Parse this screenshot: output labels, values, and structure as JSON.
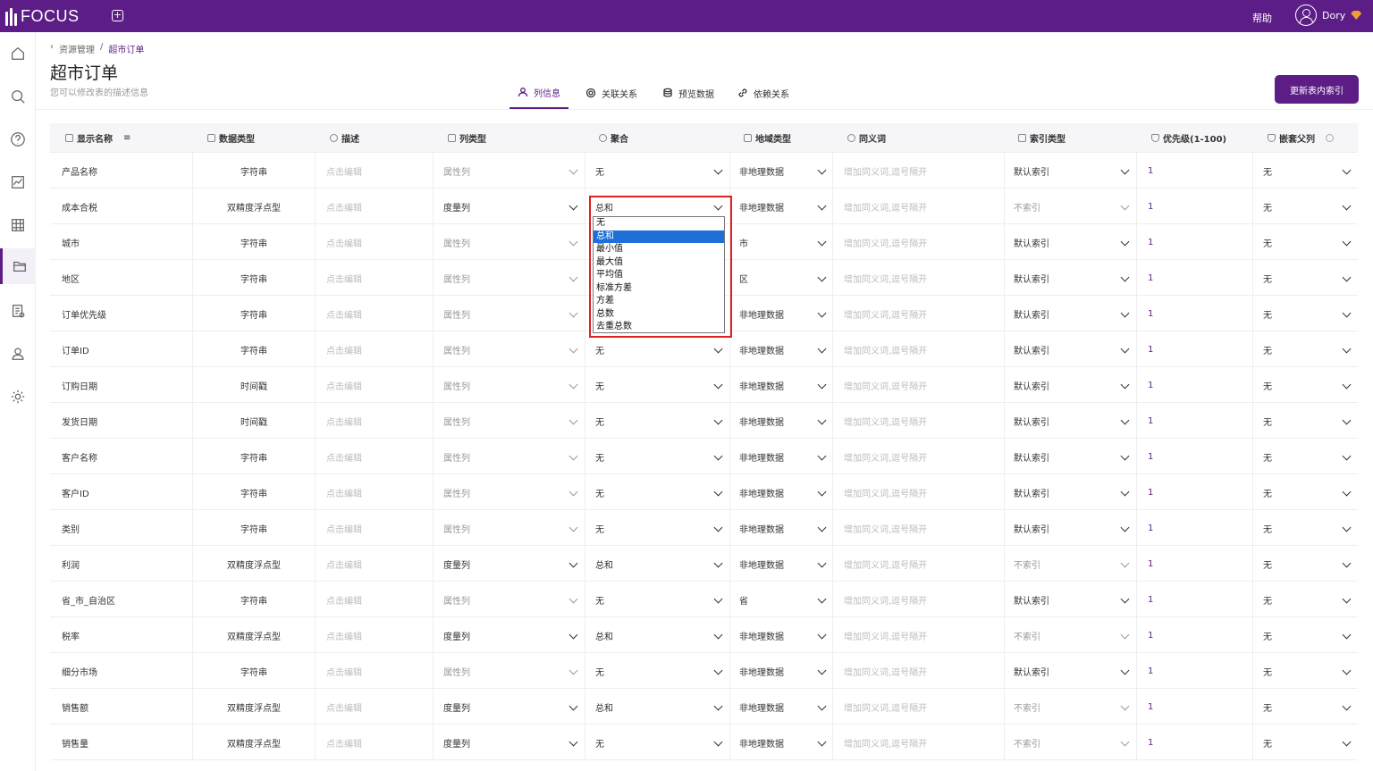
{
  "app": {
    "name": "FOCUS",
    "help": "帮助",
    "user": "Dory"
  },
  "breadcrumb": {
    "parent": "资源管理",
    "sep": "/",
    "current": "超市订单"
  },
  "page": {
    "title": "超市订单",
    "subtitle": "您可以修改表的描述信息"
  },
  "tabs": [
    "列信息",
    "关联关系",
    "预览数据",
    "依赖关系"
  ],
  "update_button": "更新表内索引",
  "columns": [
    "显示名称",
    "数据类型",
    "描述",
    "列类型",
    "聚合",
    "地域类型",
    "同义词",
    "索引类型",
    "优先级(1-100)",
    "嵌套父列"
  ],
  "placeholders": {
    "description": "点击编辑",
    "synonym": "增加同义词,逗号隔开"
  },
  "rows": [
    [
      "产品名称",
      "字符串",
      "属性列",
      "无",
      "非地理数据",
      "默认索引",
      "1",
      "无"
    ],
    [
      "成本合税",
      "双精度浮点型",
      "度量列",
      "总和",
      "非地理数据",
      "不索引",
      "1",
      "无"
    ],
    [
      "城市",
      "字符串",
      "属性列",
      "无",
      "市",
      "默认索引",
      "1",
      "无"
    ],
    [
      "地区",
      "字符串",
      "属性列",
      "无",
      "区",
      "默认索引",
      "1",
      "无"
    ],
    [
      "订单优先级",
      "字符串",
      "属性列",
      "无",
      "非地理数据",
      "默认索引",
      "1",
      "无"
    ],
    [
      "订单ID",
      "字符串",
      "属性列",
      "无",
      "非地理数据",
      "默认索引",
      "1",
      "无"
    ],
    [
      "订购日期",
      "时间戳",
      "属性列",
      "无",
      "非地理数据",
      "默认索引",
      "1",
      "无"
    ],
    [
      "发货日期",
      "时间戳",
      "属性列",
      "无",
      "非地理数据",
      "默认索引",
      "1",
      "无"
    ],
    [
      "客户名称",
      "字符串",
      "属性列",
      "无",
      "非地理数据",
      "默认索引",
      "1",
      "无"
    ],
    [
      "客户ID",
      "字符串",
      "属性列",
      "无",
      "非地理数据",
      "默认索引",
      "1",
      "无"
    ],
    [
      "类别",
      "字符串",
      "属性列",
      "无",
      "非地理数据",
      "默认索引",
      "1",
      "无"
    ],
    [
      "利润",
      "双精度浮点型",
      "度量列",
      "总和",
      "非地理数据",
      "不索引",
      "1",
      "无"
    ],
    [
      "省_市_自治区",
      "字符串",
      "属性列",
      "无",
      "省",
      "默认索引",
      "1",
      "无"
    ],
    [
      "税率",
      "双精度浮点型",
      "度量列",
      "总和",
      "非地理数据",
      "不索引",
      "1",
      "无"
    ],
    [
      "细分市场",
      "字符串",
      "属性列",
      "无",
      "非地理数据",
      "默认索引",
      "1",
      "无"
    ],
    [
      "销售额",
      "双精度浮点型",
      "度量列",
      "总和",
      "非地理数据",
      "不索引",
      "1",
      "无"
    ],
    [
      "销售量",
      "双精度浮点型",
      "度量列",
      "无",
      "非地理数据",
      "不索引",
      "1",
      "无"
    ]
  ],
  "aggregation_dropdown": {
    "options": [
      "无",
      "总和",
      "最小值",
      "最大值",
      "平均值",
      "标准方差",
      "方差",
      "总数",
      "去重总数"
    ],
    "selected": "总和"
  },
  "colors": {
    "brand": "#5c1e86",
    "highlight_border": "#e02020",
    "selected_option": "#1e6fd9"
  }
}
